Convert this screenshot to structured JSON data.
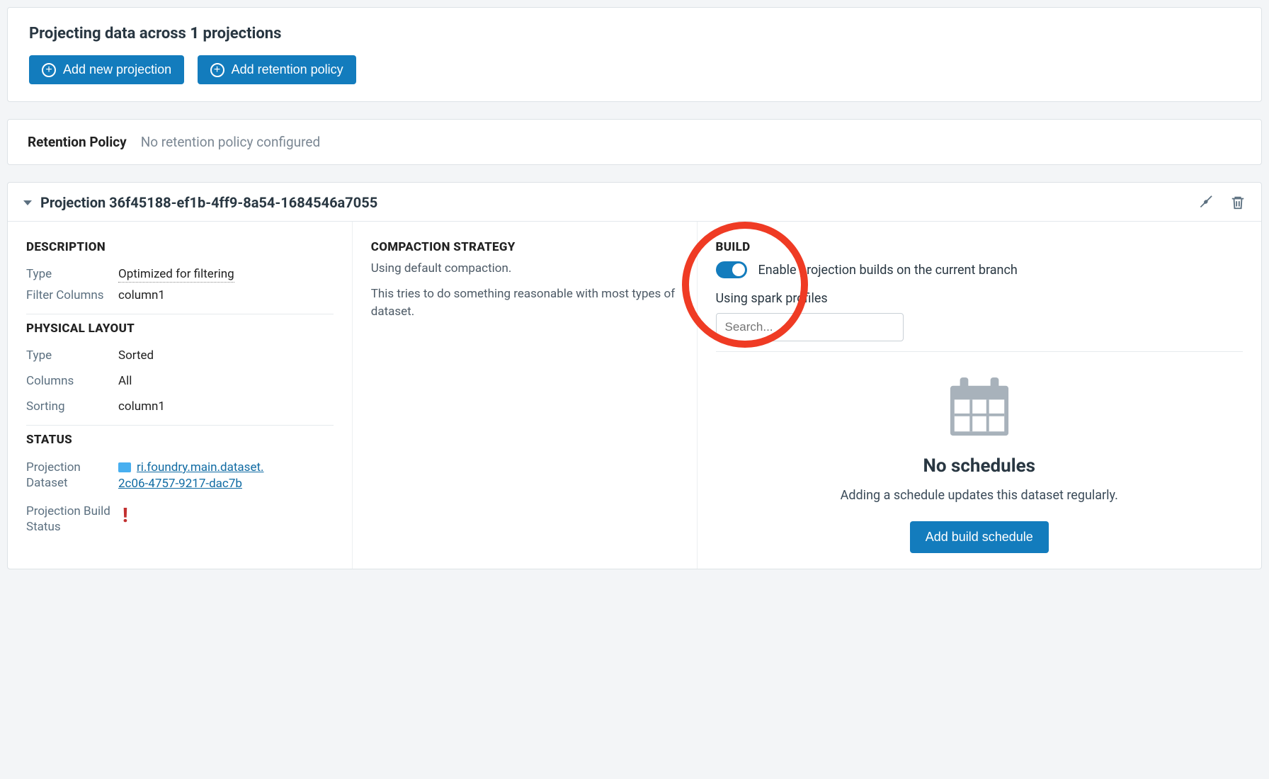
{
  "header": {
    "title_prefix": "Projecting data across ",
    "title_count": "1",
    "title_suffix": " projections",
    "add_projection_label": "Add new projection",
    "add_retention_label": "Add retention policy"
  },
  "retention": {
    "label": "Retention Policy",
    "value": "No retention policy configured"
  },
  "projection": {
    "title": "Projection 36f45188-ef1b-4ff9-8a54-1684546a7055",
    "description": {
      "heading": "DESCRIPTION",
      "type_label": "Type",
      "type_value": "Optimized for filtering",
      "filter_columns_label": "Filter Columns",
      "filter_columns_value": "column1"
    },
    "physical": {
      "heading": "PHYSICAL LAYOUT",
      "type_label": "Type",
      "type_value": "Sorted",
      "columns_label": "Columns",
      "columns_value": "All",
      "sorting_label": "Sorting",
      "sorting_value": "column1"
    },
    "status": {
      "heading": "STATUS",
      "dataset_label": "Projection Dataset",
      "dataset_value_line1": "ri.foundry.main.dataset.",
      "dataset_value_line2": "2c06-4757-9217-dac7b",
      "build_status_label": "Projection Build Status"
    },
    "compaction": {
      "heading": "COMPACTION STRATEGY",
      "line1": "Using default compaction.",
      "line2": "This tries to do something reasonable with most types of dataset."
    },
    "build": {
      "heading": "BUILD",
      "toggle_label": "Enable projection builds on the current branch",
      "spark_profiles_label": "Using spark profiles",
      "search_placeholder": "Search...",
      "no_schedules_title": "No schedules",
      "no_schedules_sub": "Adding a schedule updates this dataset regularly.",
      "add_schedule_label": "Add build schedule"
    }
  }
}
